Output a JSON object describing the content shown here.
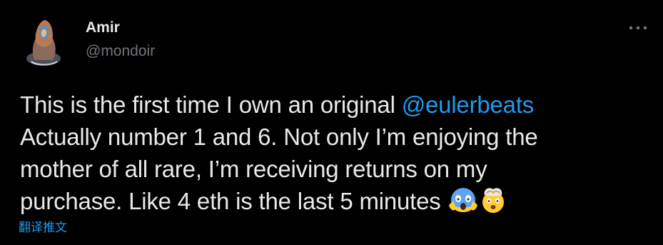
{
  "author": {
    "name": "Amir",
    "handle": "@mondoir"
  },
  "tweet": {
    "line1_prefix": "This is the first time I own an original ",
    "mention": "@eulerbeats",
    "line2": "Actually number 1 and 6. Not only I’m enjoying the",
    "line3": "mother of all rare, I’m receiving returns on my",
    "line4": "purchase. Like 4 eth is the last 5 minutes ",
    "emojis": [
      "face-screaming-in-fear",
      "exploding-head"
    ]
  },
  "translate_label": "翻译推文",
  "icons": {
    "more": "more-options-icon"
  },
  "colors": {
    "background": "#000000",
    "text": "#e7e9ea",
    "secondary": "#71767b",
    "accent": "#1d9bf0"
  }
}
